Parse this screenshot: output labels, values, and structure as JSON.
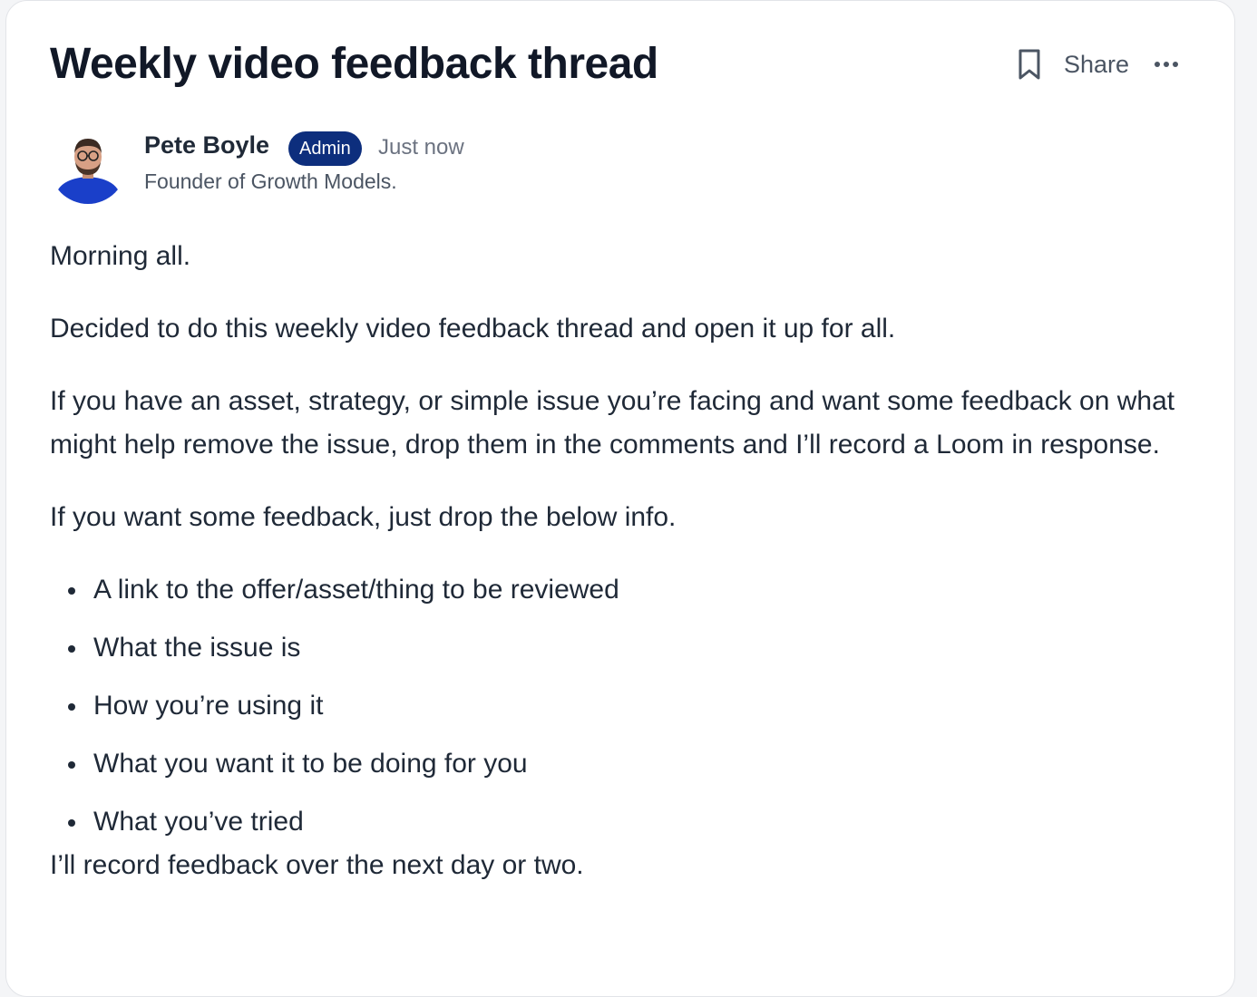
{
  "post": {
    "title": "Weekly video feedback thread",
    "actions": {
      "share_label": "Share",
      "bookmark_icon": "bookmark-icon",
      "more_icon": "more-horizontal-icon"
    },
    "author": {
      "name": "Pete Boyle",
      "badge": "Admin",
      "timestamp": "Just now",
      "tagline": "Founder of Growth Models."
    },
    "paragraphs": [
      "Morning all.",
      "Decided to do this weekly video feedback thread and open it up for all.",
      "If you have an asset, strategy, or simple issue you’re facing and want some feedback on what might help remove the issue, drop them in the comments and I’ll record a Loom in response.",
      "If you want some feedback, just drop the below info."
    ],
    "list_items": [
      "A link to the offer/asset/thing to be reviewed",
      "What the issue is",
      "How you’re using it",
      "What you want it to be doing for you",
      "What you’ve tried"
    ],
    "closing": "I’ll record feedback over the next day or two."
  },
  "colors": {
    "badge_bg": "#0d2e7d",
    "avatar_shirt": "#1a3fc9",
    "text": "#1f2937"
  }
}
